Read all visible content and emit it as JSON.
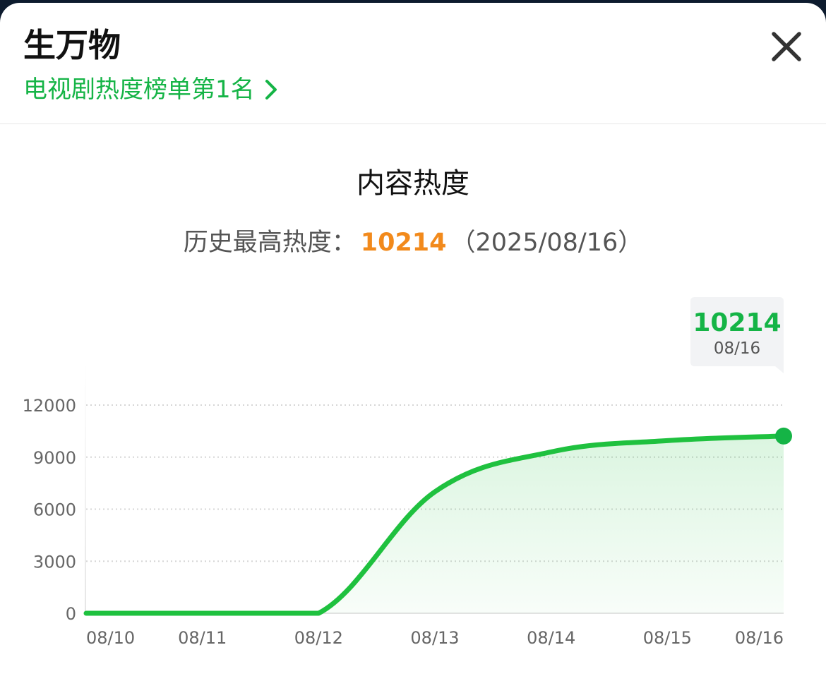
{
  "header": {
    "title": "生万物",
    "subtitle": "电视剧热度榜单第1名"
  },
  "chart_header": {
    "title": "内容热度",
    "record_label": "历史最高热度：",
    "record_value": "10214",
    "record_date": "（2025/08/16）"
  },
  "tooltip": {
    "value": "10214",
    "date": "08/16"
  },
  "colors": {
    "accent_green": "#15b446",
    "line_green": "#1fc13f",
    "record_orange": "#f28a1c"
  },
  "chart_data": {
    "type": "area",
    "x": [
      "08/10",
      "08/11",
      "08/12",
      "08/13",
      "08/14",
      "08/15",
      "08/16"
    ],
    "values": [
      0,
      0,
      0,
      7000,
      9300,
      9950,
      10214
    ],
    "y_ticks": [
      0,
      3000,
      6000,
      9000,
      12000
    ],
    "ylim": [
      0,
      12000
    ],
    "grid": true,
    "highlight_point": {
      "x": "08/16",
      "value": 10214
    }
  }
}
